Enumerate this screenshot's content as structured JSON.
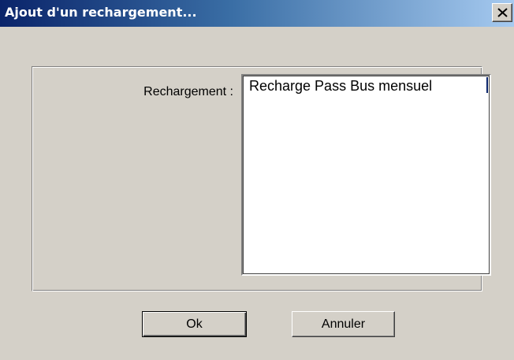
{
  "window": {
    "title": "Ajout d'un rechargement...",
    "close_icon": "close-icon"
  },
  "form": {
    "label": "Rechargement :",
    "list_items": [
      "Recharge Pass Bus mensuel"
    ]
  },
  "buttons": {
    "ok_label": "Ok",
    "cancel_label": "Annuler"
  },
  "colors": {
    "titlebar_start": "#0a246a",
    "titlebar_end": "#a6caf0",
    "face": "#d4d0c8"
  }
}
